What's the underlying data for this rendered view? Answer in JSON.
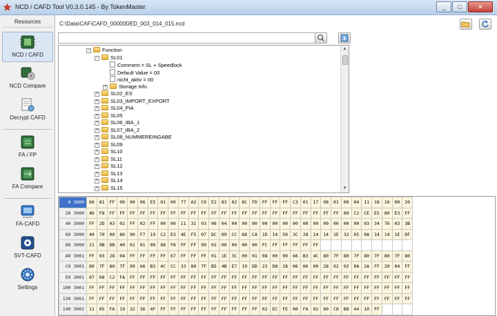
{
  "window": {
    "title": "NCD / CAFD Tool V0.3.0.145 - By TokenMaster",
    "minimize": "_",
    "maximize": "□",
    "close": "✕"
  },
  "sidebar": {
    "header": "Resources",
    "items": [
      {
        "label": "NCD / CAFD",
        "icon": "ecu-chip-icon"
      },
      {
        "label": "NCD Compare",
        "icon": "compare-gear-icon"
      },
      {
        "label": "Decrypt CAFD",
        "icon": "decrypt-icon"
      },
      {
        "label": "FA / FP",
        "icon": "fa-chip-icon"
      },
      {
        "label": "FA Compare",
        "icon": "fa-compare-icon"
      },
      {
        "label": "FA-CAFD",
        "icon": "fa-cafd-icon"
      },
      {
        "label": "SVT-CAFD",
        "icon": "svt-cafd-icon"
      },
      {
        "label": "Settings",
        "icon": "settings-gear-icon"
      }
    ]
  },
  "path": {
    "value": "C:\\Data\\CAF\\CAFD_00000DED_003_014_015.ncd"
  },
  "search": {
    "value": "",
    "placeholder": ""
  },
  "tree": {
    "nodes": [
      {
        "label": "Function",
        "level": 0,
        "type": "folder",
        "expander": "−"
      },
      {
        "label": "SL01",
        "level": 1,
        "type": "folder",
        "expander": "−"
      },
      {
        "label": "Comment = SL + Speedlock",
        "level": 2,
        "type": "doc",
        "expander": ""
      },
      {
        "label": "Default Value = 00",
        "level": 2,
        "type": "doc",
        "expander": ""
      },
      {
        "label": "nicht_aktiv = 00",
        "level": 2,
        "type": "doc",
        "expander": ""
      },
      {
        "label": "Storage Info",
        "level": 2,
        "type": "folder",
        "expander": "+"
      },
      {
        "label": "SL02_ES",
        "level": 1,
        "type": "folder",
        "expander": "+"
      },
      {
        "label": "SL03_IMPORT_EXPORT",
        "level": 1,
        "type": "folder",
        "expander": "+"
      },
      {
        "label": "SL04_PIA",
        "level": 1,
        "type": "folder",
        "expander": "+"
      },
      {
        "label": "SL05",
        "level": 1,
        "type": "folder",
        "expander": "+"
      },
      {
        "label": "SL06_IBA_1",
        "level": 1,
        "type": "folder",
        "expander": "+"
      },
      {
        "label": "SL07_IBA_2",
        "level": 1,
        "type": "folder",
        "expander": "+"
      },
      {
        "label": "SL08_NUMMEREINGABE",
        "level": 1,
        "type": "folder",
        "expander": "+"
      },
      {
        "label": "SL09",
        "level": 1,
        "type": "folder",
        "expander": "+"
      },
      {
        "label": "SL10",
        "level": 1,
        "type": "folder",
        "expander": "+"
      },
      {
        "label": "SL11",
        "level": 1,
        "type": "folder",
        "expander": "+"
      },
      {
        "label": "SL12",
        "level": 1,
        "type": "folder",
        "expander": "+"
      },
      {
        "label": "SL13",
        "level": 1,
        "type": "folder",
        "expander": "+"
      },
      {
        "label": "SL14",
        "level": 1,
        "type": "folder",
        "expander": "+"
      },
      {
        "label": "SL15",
        "level": 1,
        "type": "folder",
        "expander": "+"
      }
    ]
  },
  "hex": {
    "rows": [
      {
        "addr": "0 3000",
        "bytes": [
          "60",
          "81",
          "FF",
          "00",
          "00",
          "06",
          "E5",
          "01",
          "00",
          "77",
          "A2",
          "C0",
          "E2",
          "83",
          "02",
          "8C",
          "FD",
          "FF",
          "FF",
          "FF",
          "C3",
          "01",
          "17",
          "08",
          "01",
          "00",
          "04",
          "11",
          "18",
          "10",
          "00",
          "20"
        ]
      },
      {
        "addr": "20 3000",
        "bytes": [
          "4D",
          "F8",
          "FF",
          "FF",
          "FF",
          "FF",
          "FF",
          "FF",
          "FF",
          "FF",
          "FF",
          "FF",
          "FF",
          "FF",
          "FF",
          "FF",
          "FF",
          "FF",
          "FF",
          "FF",
          "FF",
          "FF",
          "FF",
          "FF",
          "FF",
          "80",
          "C2",
          "CE",
          "E5",
          "80",
          "E3",
          "FF"
        ]
      },
      {
        "addr": "40 3000",
        "bytes": [
          "FF",
          "2D",
          "03",
          "02",
          "FF",
          "02",
          "FF",
          "00",
          "00",
          "11",
          "31",
          "03",
          "06",
          "04",
          "00",
          "00",
          "00",
          "00",
          "00",
          "00",
          "00",
          "00",
          "00",
          "00",
          "00",
          "00",
          "00",
          "03",
          "34",
          "76",
          "03",
          "3B"
        ]
      },
      {
        "addr": "60 3000",
        "bytes": [
          "40",
          "70",
          "00",
          "80",
          "90",
          "F7",
          "19",
          "C2",
          "E3",
          "4E",
          "F5",
          "07",
          "DC",
          "09",
          "CC",
          "68",
          "CA",
          "1D",
          "14",
          "50",
          "3C",
          "28",
          "14",
          "14",
          "1E",
          "32",
          "05",
          "0A",
          "14",
          "14",
          "1E",
          "DF"
        ]
      },
      {
        "addr": "80 3000",
        "bytes": [
          "21",
          "9B",
          "DB",
          "40",
          "01",
          "01",
          "00",
          "88",
          "F8",
          "FF",
          "FF",
          "90",
          "02",
          "00",
          "00",
          "00",
          "00",
          "FC",
          "FF",
          "FF",
          "FF",
          "FF",
          "FF",
          "",
          "",
          "",
          "",
          "",
          "",
          "",
          "",
          ""
        ]
      },
      {
        "addr": "A0 3001",
        "bytes": [
          "FF",
          "93",
          "28",
          "04",
          "FF",
          "FF",
          "FF",
          "FF",
          "67",
          "FF",
          "FF",
          "FF",
          "01",
          "1E",
          "3C",
          "00",
          "01",
          "08",
          "00",
          "99",
          "66",
          "B3",
          "4C",
          "80",
          "7F",
          "80",
          "7F",
          "80",
          "7F",
          "80",
          "7F",
          "80"
        ]
      },
      {
        "addr": "C0 3001",
        "bytes": [
          "80",
          "7F",
          "80",
          "7F",
          "99",
          "66",
          "B3",
          "4C",
          "CC",
          "33",
          "80",
          "7F",
          "B5",
          "4B",
          "E7",
          "19",
          "DD",
          "23",
          "D8",
          "28",
          "06",
          "06",
          "00",
          "28",
          "02",
          "02",
          "0A",
          "2A",
          "FF",
          "20",
          "04",
          "FF"
        ]
      },
      {
        "addr": "E0 3001",
        "bytes": [
          "07",
          "08",
          "C2",
          "FA",
          "FF",
          "FF",
          "FF",
          "FF",
          "FF",
          "FF",
          "FF",
          "FF",
          "FF",
          "FF",
          "FF",
          "FF",
          "FF",
          "FF",
          "FF",
          "FF",
          "FF",
          "FF",
          "FF",
          "FF",
          "FF",
          "FF",
          "FF",
          "FF",
          "FF",
          "FF",
          "FF",
          "FF"
        ]
      },
      {
        "addr": "100 3001",
        "bytes": [
          "FF",
          "FF",
          "FF",
          "FF",
          "FF",
          "FF",
          "FF",
          "FF",
          "FF",
          "FF",
          "FF",
          "FF",
          "FF",
          "FF",
          "FF",
          "FF",
          "FF",
          "FF",
          "FF",
          "FF",
          "FF",
          "FF",
          "FF",
          "FF",
          "FF",
          "FF",
          "FF",
          "FF",
          "FF",
          "FF",
          "FF",
          "FF"
        ]
      },
      {
        "addr": "120 3001",
        "bytes": [
          "FF",
          "FF",
          "FF",
          "FF",
          "FF",
          "FF",
          "FF",
          "FF",
          "FF",
          "FF",
          "FF",
          "FF",
          "FF",
          "FF",
          "FF",
          "FF",
          "FF",
          "FF",
          "FF",
          "FF",
          "FF",
          "FF",
          "FF",
          "FF",
          "FF",
          "FF",
          "FF",
          "FF",
          "FF",
          "FF",
          "FF",
          "FF"
        ]
      },
      {
        "addr": "140 3002",
        "bytes": [
          "11",
          "05",
          "FA",
          "19",
          "32",
          "36",
          "4F",
          "FF",
          "FF",
          "FF",
          "FF",
          "FF",
          "FF",
          "FF",
          "FF",
          "FF",
          "FF",
          "02",
          "EC",
          "FE",
          "00",
          "FA",
          "02",
          "80",
          "C8",
          "B8",
          "44",
          "10",
          "FF",
          "",
          "",
          ""
        ]
      },
      {
        "addr": "160 3002",
        "bytes": [
          "FF",
          "FF",
          "FF",
          "FF",
          "FF",
          "FF",
          "FF",
          "FF",
          "FF",
          "FF",
          "FF",
          "FF",
          "FF",
          "FF",
          "FF",
          "FF",
          "FF",
          "FF",
          "FF",
          "FF",
          "FF",
          "FF",
          "FF",
          "FF",
          "FF",
          "FF",
          "FF",
          "FF",
          "FF",
          "FF",
          "FF",
          "FF"
        ]
      }
    ]
  },
  "colors": {
    "accent": "#3f72c8",
    "hexcell": "#fbf6dd"
  }
}
